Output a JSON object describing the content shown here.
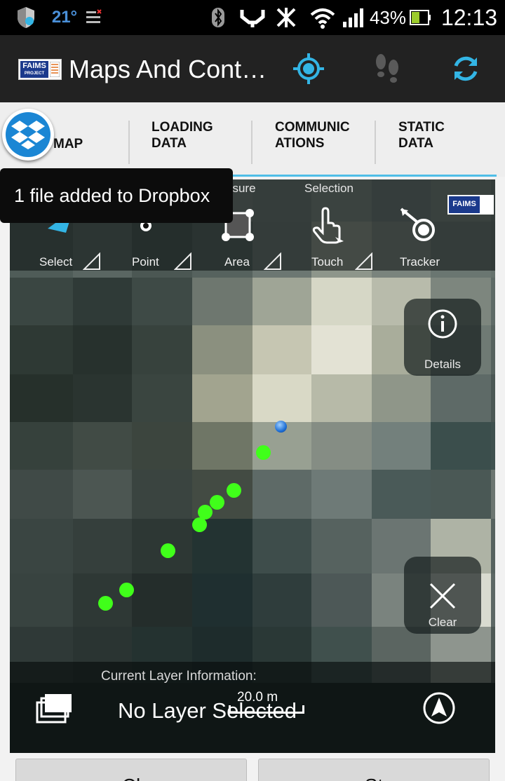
{
  "status_bar": {
    "temperature": "21°",
    "battery_percent": "43%",
    "time": "12:13",
    "icons": [
      "shield-icon",
      "notification-list-icon",
      "bluetooth-icon",
      "usb-icon",
      "signal-off-icon",
      "wifi-icon",
      "cell-signal-icon",
      "battery-icon"
    ]
  },
  "action_bar": {
    "logo_text": "FAIMS",
    "logo_subtext": "PROJECT",
    "title": "Maps And Cont…",
    "actions": [
      "gps-target-icon",
      "footsteps-icon",
      "sync-icon"
    ],
    "accent": "#33b5e5"
  },
  "tabs": [
    {
      "label": "MAP",
      "selected": true
    },
    {
      "label": "LOADING DATA",
      "line1": "LOADING",
      "line2": "DATA"
    },
    {
      "label": "COMMUNICATIONS",
      "line1": "COMMUNIC",
      "line2": "ATIONS"
    },
    {
      "label": "STATIC DATA",
      "line1": "STATIC",
      "line2": "DATA"
    }
  ],
  "map_toolbar": {
    "tools": [
      {
        "label": "Select"
      },
      {
        "label": "Point"
      },
      {
        "label": "Area",
        "group": "asure"
      },
      {
        "label": "Touch",
        "group": "Selection"
      },
      {
        "label": "Tracker"
      }
    ],
    "logo_text": "FAIMS"
  },
  "map_buttons": {
    "details": "Details",
    "clear": "Clear"
  },
  "layer_info": {
    "title": "Current Layer Information:",
    "name": "No Layer Selected",
    "scale": "20.0 m"
  },
  "bottom_buttons": [
    {
      "label": "Cl"
    },
    {
      "label": "St"
    }
  ],
  "toast": {
    "message": "1 file added to Dropbox"
  }
}
